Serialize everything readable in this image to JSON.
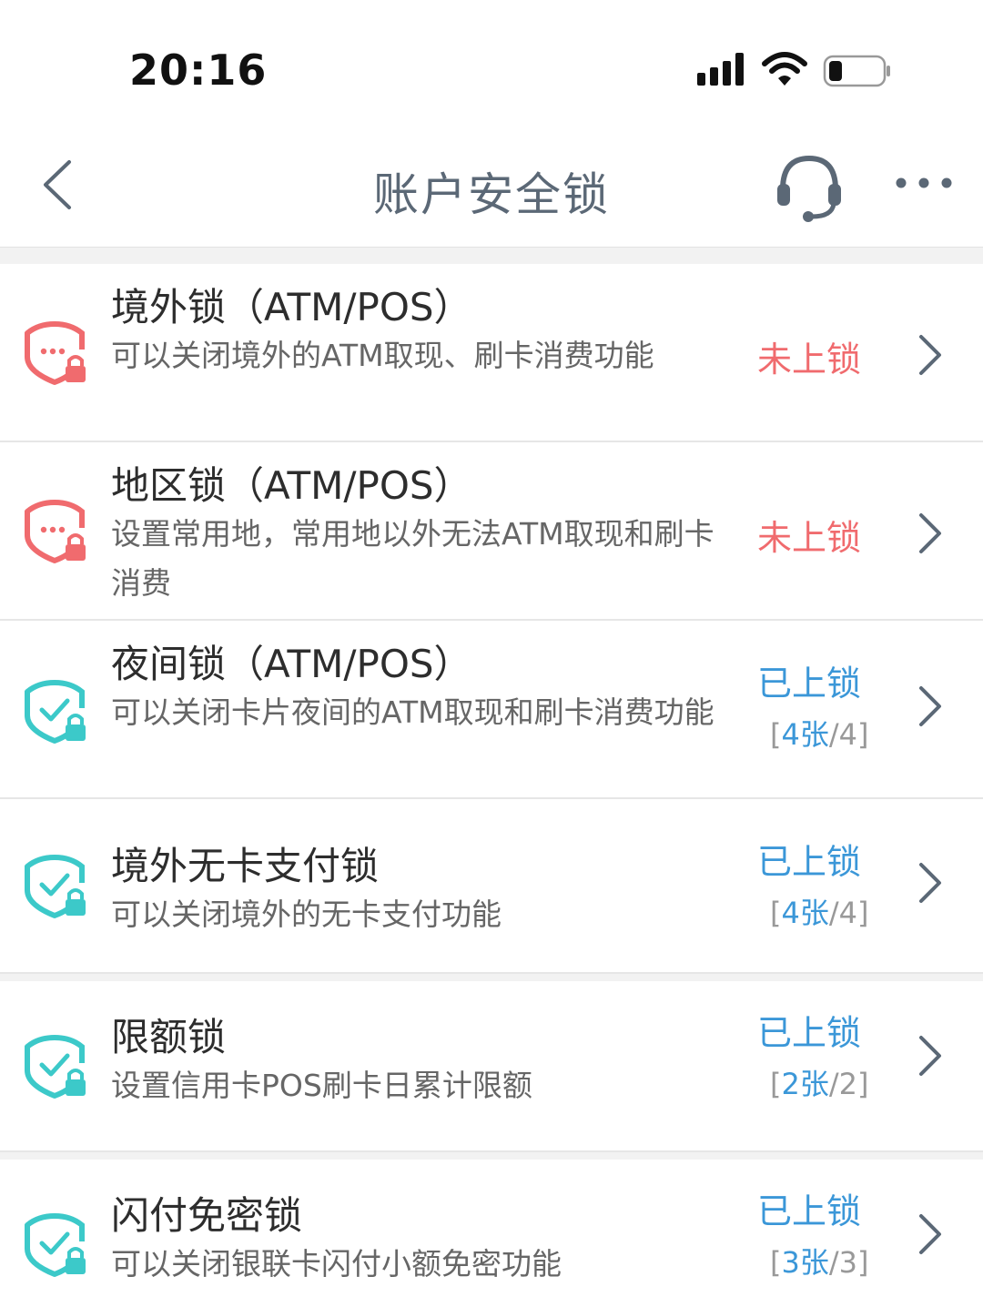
{
  "status_bar": {
    "time": "20:16"
  },
  "nav": {
    "title": "账户安全锁"
  },
  "colors": {
    "unlocked": "#f06b6e",
    "locked": "#3b97d8",
    "icon_locked": "#3cc9c9"
  },
  "items": [
    {
      "title": "境外锁（ATM/POS）",
      "desc": "可以关闭境外的ATM取现、刷卡消费功能",
      "status": "未上锁",
      "locked": false,
      "count_num": "",
      "count_total": ""
    },
    {
      "title": "地区锁（ATM/POS）",
      "desc": "设置常用地，常用地以外无法ATM取现和刷卡消费",
      "status": "未上锁",
      "locked": false,
      "count_num": "",
      "count_total": ""
    },
    {
      "title": "夜间锁（ATM/POS）",
      "desc": "可以关闭卡片夜间的ATM取现和刷卡消费功能",
      "status": "已上锁",
      "locked": true,
      "count_num": "4张",
      "count_total": "4"
    },
    {
      "title": "境外无卡支付锁",
      "desc": "可以关闭境外的无卡支付功能",
      "status": "已上锁",
      "locked": true,
      "count_num": "4张",
      "count_total": "4"
    },
    {
      "title": "限额锁",
      "desc": "设置信用卡POS刷卡日累计限额",
      "status": "已上锁",
      "locked": true,
      "count_num": "2张",
      "count_total": "2"
    },
    {
      "title": "闪付免密锁",
      "desc": "可以关闭银联卡闪付小额免密功能",
      "status": "已上锁",
      "locked": true,
      "count_num": "3张",
      "count_total": "3"
    }
  ]
}
